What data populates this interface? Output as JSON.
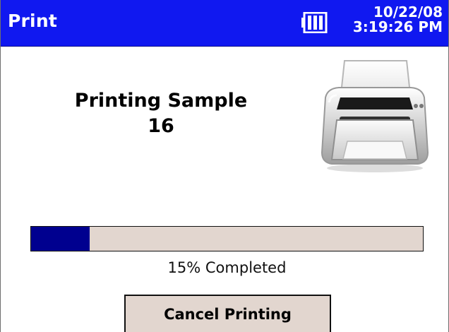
{
  "window": {
    "title": "Print",
    "date": "10/22/08",
    "time": "3:19:26 PM",
    "battery_icon": "battery-icon"
  },
  "print_job": {
    "line1": "Printing Sample",
    "line2": "16",
    "icon": "printer-icon"
  },
  "progress": {
    "fraction": 0.15,
    "text": "15% Completed"
  },
  "actions": {
    "cancel_label": "Cancel Printing"
  },
  "colors": {
    "titlebar": "#1018f0",
    "progress_fill": "#00008f",
    "control_bg": "#e2d6cf"
  }
}
